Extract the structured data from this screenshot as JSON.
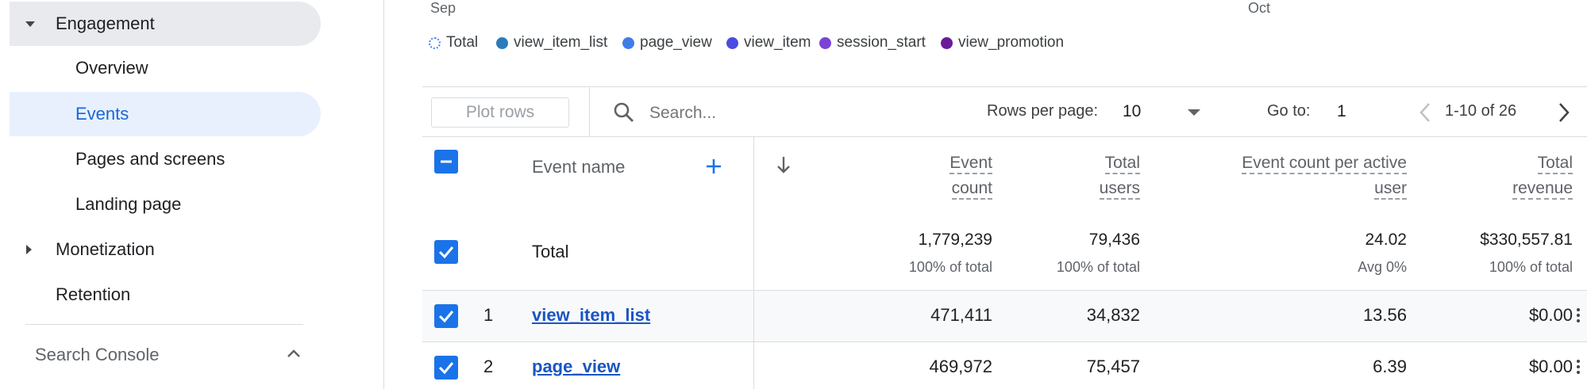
{
  "sidebar": {
    "items": [
      {
        "label": "Engagement"
      },
      {
        "label": "Overview"
      },
      {
        "label": "Events"
      },
      {
        "label": "Pages and screens"
      },
      {
        "label": "Landing page"
      },
      {
        "label": "Monetization"
      },
      {
        "label": "Retention"
      }
    ],
    "section": {
      "label": "Search Console"
    }
  },
  "chart": {
    "x_labels": [
      "Sep",
      "Oct"
    ],
    "legend": [
      {
        "label": "Total",
        "color": "#4285f4"
      },
      {
        "label": "view_item_list",
        "color": "#2b7bba"
      },
      {
        "label": "page_view",
        "color": "#3f7ee8"
      },
      {
        "label": "view_item",
        "color": "#4c4ae0"
      },
      {
        "label": "session_start",
        "color": "#7a43d6"
      },
      {
        "label": "view_promotion",
        "color": "#6a1b9a"
      }
    ]
  },
  "toolbar": {
    "plot_rows_label": "Plot rows",
    "search_placeholder": "Search...",
    "rows_per_page_label": "Rows per page:",
    "rows_per_page_value": "10",
    "goto_label": "Go to:",
    "goto_value": "1",
    "pagination_text": "1-10 of 26"
  },
  "table": {
    "headers": {
      "event_name": "Event name",
      "event_count": [
        "Event",
        "count"
      ],
      "total_users": [
        "Total",
        "users"
      ],
      "per_user": [
        "Event count per active",
        "user"
      ],
      "total_revenue": [
        "Total",
        "revenue"
      ]
    },
    "total": {
      "label": "Total",
      "event_count": "1,779,239",
      "event_count_sub": "100% of total",
      "total_users": "79,436",
      "total_users_sub": "100% of total",
      "per_user": "24.02",
      "per_user_sub": "Avg 0%",
      "total_revenue": "$330,557.81",
      "total_revenue_sub": "100% of total"
    },
    "rows": [
      {
        "index": "1",
        "name": "view_item_list",
        "event_count": "471,411",
        "total_users": "34,832",
        "per_user": "13.56",
        "total_revenue": "$0.00"
      },
      {
        "index": "2",
        "name": "page_view",
        "event_count": "469,972",
        "total_users": "75,457",
        "per_user": "6.39",
        "total_revenue": "$0.00"
      }
    ]
  }
}
